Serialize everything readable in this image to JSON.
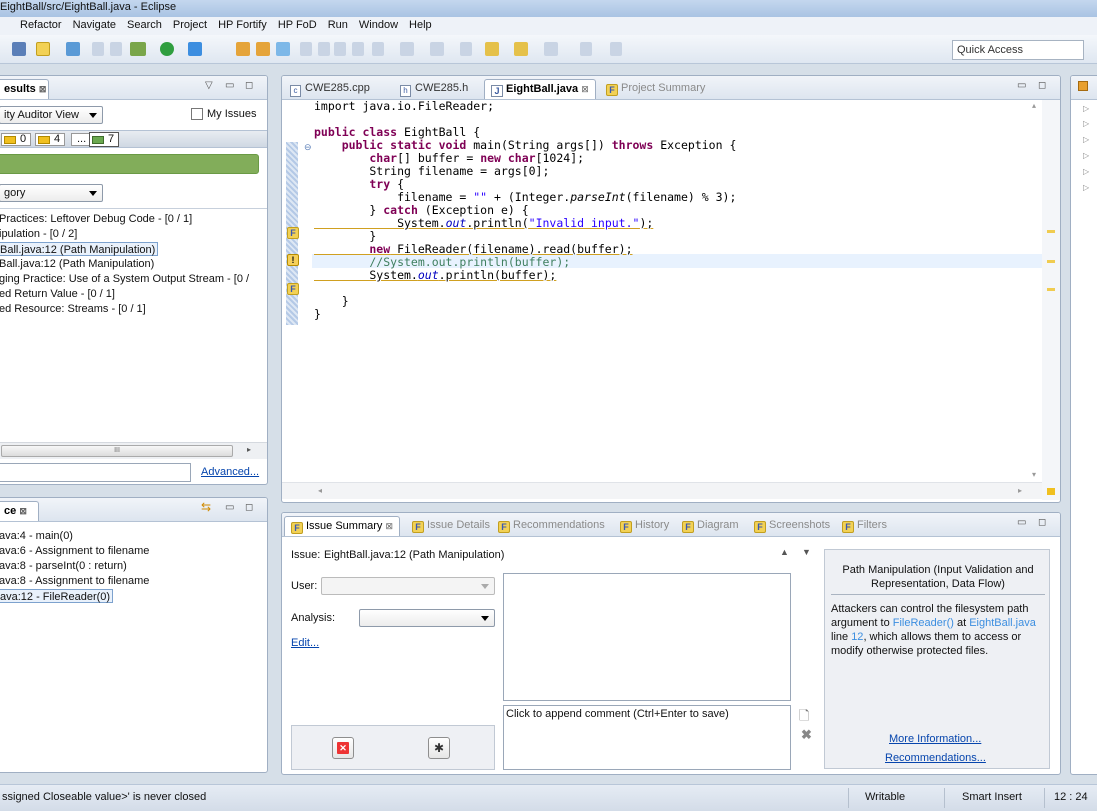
{
  "window": {
    "title": "EightBall/src/EightBall.java - Eclipse"
  },
  "menu": [
    "Refactor",
    "Navigate",
    "Search",
    "Project",
    "HP Fortify",
    "HP FoD",
    "Run",
    "Window",
    "Help"
  ],
  "toolbar": {
    "quick_access": "Quick Access"
  },
  "results_panel": {
    "tab_label": "esults",
    "view_select": "ity Auditor View",
    "my_issues_label": "My Issues",
    "counts": [
      {
        "value": "0",
        "color": "#f0c020"
      },
      {
        "value": "4",
        "color": "#f0c020"
      },
      {
        "value": "...",
        "color": ""
      },
      {
        "value": "7",
        "color": "#6aa84f"
      }
    ],
    "group_select": "gory",
    "items": [
      "Practices: Leftover Debug Code - [0 / 1]",
      "ipulation - [0 / 2]",
      "Ball.java:12 (Path Manipulation)",
      "Ball.java:12 (Path Manipulation)",
      "ging Practice: Use of a System Output Stream - [0 /",
      "ed Return Value - [0 / 1]",
      "ed Resource: Streams - [0 / 1]"
    ],
    "selected_index": 2,
    "advanced_link": "Advanced..."
  },
  "trace_panel": {
    "tab_label": "ce",
    "items": [
      "ava:4 - main(0)",
      "ava:6 - Assignment to filename",
      "ava:8 - parseInt(0 : return)",
      "ava:8 - Assignment to filename",
      "ava:12 - FileReader(0)"
    ],
    "selected_index": 4
  },
  "editor": {
    "tabs": [
      {
        "label": "CWE285.cpp",
        "icon": "c"
      },
      {
        "label": "CWE285.h",
        "icon": "h"
      },
      {
        "label": "EightBall.java",
        "icon": "j",
        "active": true
      },
      {
        "label": "Project Summary",
        "icon": "f"
      }
    ],
    "code": [
      {
        "segments": [
          {
            "t": "import java.io.FileReader;",
            "c": ""
          }
        ]
      },
      {
        "segments": []
      },
      {
        "segments": [
          {
            "t": "public class",
            "c": "kw"
          },
          {
            "t": " EightBall {",
            "c": ""
          }
        ]
      },
      {
        "segments": [
          {
            "t": "    public static void",
            "c": "kw"
          },
          {
            "t": " main(String args[]) ",
            "c": ""
          },
          {
            "t": "throws",
            "c": "kw"
          },
          {
            "t": " Exception {",
            "c": ""
          }
        ]
      },
      {
        "segments": [
          {
            "t": "        char",
            "c": "kw"
          },
          {
            "t": "[] buffer = ",
            "c": ""
          },
          {
            "t": "new char",
            "c": "kw"
          },
          {
            "t": "[1024];",
            "c": ""
          }
        ]
      },
      {
        "segments": [
          {
            "t": "        String filename = args[0];",
            "c": ""
          }
        ]
      },
      {
        "segments": [
          {
            "t": "        try",
            "c": "kw"
          },
          {
            "t": " {",
            "c": ""
          }
        ]
      },
      {
        "segments": [
          {
            "t": "            filename = ",
            "c": ""
          },
          {
            "t": "\"\"",
            "c": "str"
          },
          {
            "t": " + (Integer.",
            "c": ""
          },
          {
            "t": "parseInt",
            "c": "itl"
          },
          {
            "t": "(filename) % 3);",
            "c": ""
          }
        ]
      },
      {
        "segments": [
          {
            "t": "        } ",
            "c": ""
          },
          {
            "t": "catch",
            "c": "kw"
          },
          {
            "t": " (Exception e) {",
            "c": ""
          }
        ]
      },
      {
        "segments": [
          {
            "t": "            System.",
            "c": "ul"
          },
          {
            "t": "out",
            "c": "fld ul"
          },
          {
            "t": ".println(",
            "c": "ul"
          },
          {
            "t": "\"Invalid input.\"",
            "c": "str ul"
          },
          {
            "t": ");",
            "c": "ul"
          }
        ]
      },
      {
        "segments": [
          {
            "t": "        }",
            "c": ""
          }
        ]
      },
      {
        "segments": [
          {
            "t": "        new",
            "c": "kw ul"
          },
          {
            "t": " FileReader(filename).read(buffer);",
            "c": "ul"
          }
        ]
      },
      {
        "segments": [
          {
            "t": "        //System.out.println(buffer);",
            "c": "cm"
          }
        ]
      },
      {
        "segments": [
          {
            "t": "        System.",
            "c": "ul"
          },
          {
            "t": "out",
            "c": "fld ul"
          },
          {
            "t": ".println(buffer);",
            "c": "ul"
          }
        ]
      },
      {
        "segments": []
      },
      {
        "segments": [
          {
            "t": "    }",
            "c": ""
          }
        ]
      },
      {
        "segments": [
          {
            "t": "}",
            "c": ""
          }
        ]
      }
    ]
  },
  "issue_panel": {
    "tabs": [
      "Issue Summary",
      "Issue Details",
      "Recommendations",
      "History",
      "Diagram",
      "Screenshots",
      "Filters"
    ],
    "issue_label": "Issue:",
    "issue_title": "EightBall.java:12 (Path Manipulation)",
    "user_label": "User:",
    "analysis_label": "Analysis:",
    "edit_link": "Edit...",
    "comment_placeholder": "Click to append comment (Ctrl+Enter to save)",
    "detail_heading": "Path Manipulation (Input Validation and Representation, Data Flow)",
    "detail_text_1": "Attackers can control the filesystem path argument to ",
    "detail_link_1": "FileReader()",
    "detail_text_2": " at ",
    "detail_link_2": "EightBall.java",
    "detail_text_3": " line ",
    "detail_link_3": "12",
    "detail_text_4": ", which allows them to access or modify otherwise protected files.",
    "more_info_link": "More Information...",
    "recommendations_link": "Recommendations..."
  },
  "statusbar": {
    "message": "ssigned Closeable value>' is never closed",
    "writable": "Writable",
    "insert_mode": "Smart Insert",
    "position": "12 : 24"
  }
}
